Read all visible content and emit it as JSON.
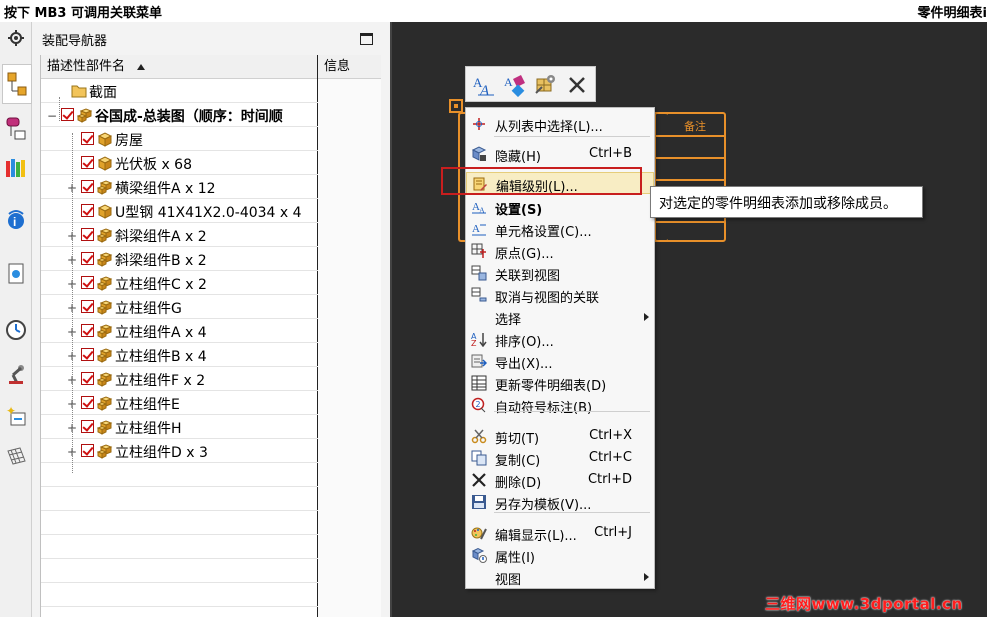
{
  "annotation": {
    "left": "按下 MB3 可调用关联菜单",
    "right": "零件明细表i"
  },
  "resource_bar": {
    "icons": [
      "gear-icon",
      "assembly-navigator-icon",
      "constraint-navigator-icon",
      "library-icon",
      "web-browser-icon",
      "document-icon",
      "history-icon",
      "robot-icon",
      "template-icon",
      "grid-icon"
    ]
  },
  "navigator": {
    "title": "装配导航器",
    "col_name": "描述性部件名",
    "col_info": "信息",
    "rows": [
      {
        "label": "截面",
        "expander": "",
        "check": false,
        "icon": "folder"
      },
      {
        "label": "谷国成-总装图（顺序：时间顺",
        "expander": "−",
        "check": true,
        "icon": "assembly",
        "bold": true
      },
      {
        "label": "房屋",
        "expander": "",
        "check": true,
        "icon": "part"
      },
      {
        "label": "光伏板 x 68",
        "expander": "",
        "check": true,
        "icon": "part"
      },
      {
        "label": "横梁组件A x 12",
        "expander": "+",
        "check": true,
        "icon": "assembly"
      },
      {
        "label": "U型钢 41X41X2.0-4034 x 4",
        "expander": "",
        "check": true,
        "icon": "part"
      },
      {
        "label": "斜梁组件A x 2",
        "expander": "+",
        "check": true,
        "icon": "assembly"
      },
      {
        "label": "斜梁组件B x 2",
        "expander": "+",
        "check": true,
        "icon": "assembly"
      },
      {
        "label": "立柱组件C x 2",
        "expander": "+",
        "check": true,
        "icon": "assembly"
      },
      {
        "label": "立柱组件G",
        "expander": "+",
        "check": true,
        "icon": "assembly"
      },
      {
        "label": "立柱组件A x 4",
        "expander": "+",
        "check": true,
        "icon": "assembly"
      },
      {
        "label": "立柱组件B x 4",
        "expander": "+",
        "check": true,
        "icon": "assembly"
      },
      {
        "label": "立柱组件F x 2",
        "expander": "+",
        "check": true,
        "icon": "assembly"
      },
      {
        "label": "立柱组件E",
        "expander": "+",
        "check": true,
        "icon": "assembly"
      },
      {
        "label": "立柱组件H",
        "expander": "+",
        "check": true,
        "icon": "assembly"
      },
      {
        "label": "立柱组件D x 3",
        "expander": "+",
        "check": true,
        "icon": "assembly"
      }
    ]
  },
  "graphics": {
    "table_header_text": "备注",
    "colors": {
      "accent": "#e8902a",
      "background": "#2b2b2b"
    }
  },
  "minibar": {
    "icons": [
      "annotation-style-icon",
      "settings-icon",
      "cell-settings-icon",
      "delete-icon"
    ]
  },
  "menu": {
    "items": [
      {
        "label": "从列表中选择(L)...",
        "shortcut": "",
        "icon": "select-from-list-icon"
      },
      {
        "label": "隐藏(H)",
        "shortcut": "Ctrl+B",
        "icon": "hide-icon"
      },
      {
        "label": "编辑级别(L)...",
        "shortcut": "",
        "icon": "edit-level-icon",
        "highlight": true
      },
      {
        "label": "设置(S)",
        "shortcut": "",
        "icon": "settings-icon",
        "bold": true
      },
      {
        "label": "单元格设置(C)...",
        "shortcut": "",
        "icon": "cell-settings-icon"
      },
      {
        "label": "原点(G)...",
        "shortcut": "",
        "icon": "origin-icon"
      },
      {
        "label": "关联到视图",
        "shortcut": "",
        "icon": "associate-view-icon"
      },
      {
        "label": "取消与视图的关联",
        "shortcut": "",
        "icon": "disassociate-view-icon"
      },
      {
        "label": "选择",
        "shortcut": "",
        "icon": "",
        "submenu": true
      },
      {
        "label": "排序(O)...",
        "shortcut": "",
        "icon": "sort-icon"
      },
      {
        "label": "导出(X)...",
        "shortcut": "",
        "icon": "export-icon"
      },
      {
        "label": "更新零件明细表(D)",
        "shortcut": "",
        "icon": "update-table-icon"
      },
      {
        "label": "自动符号标注(B)",
        "shortcut": "",
        "icon": "auto-balloon-icon"
      },
      {
        "label": "剪切(T)",
        "shortcut": "Ctrl+X",
        "icon": "cut-icon"
      },
      {
        "label": "复制(C)",
        "shortcut": "Ctrl+C",
        "icon": "copy-icon"
      },
      {
        "label": "删除(D)",
        "shortcut": "Ctrl+D",
        "icon": "delete-icon"
      },
      {
        "label": "另存为模板(V)...",
        "shortcut": "",
        "icon": "save-template-icon"
      },
      {
        "label": "编辑显示(L)...",
        "shortcut": "Ctrl+J",
        "icon": "edit-display-icon"
      },
      {
        "label": "属性(I)",
        "shortcut": "",
        "icon": "properties-icon"
      },
      {
        "label": "视图",
        "shortcut": "",
        "icon": "",
        "submenu": true
      }
    ]
  },
  "tooltip": "对选定的零件明细表添加或移除成员。",
  "watermark": "三维网www.3dportal.cn"
}
